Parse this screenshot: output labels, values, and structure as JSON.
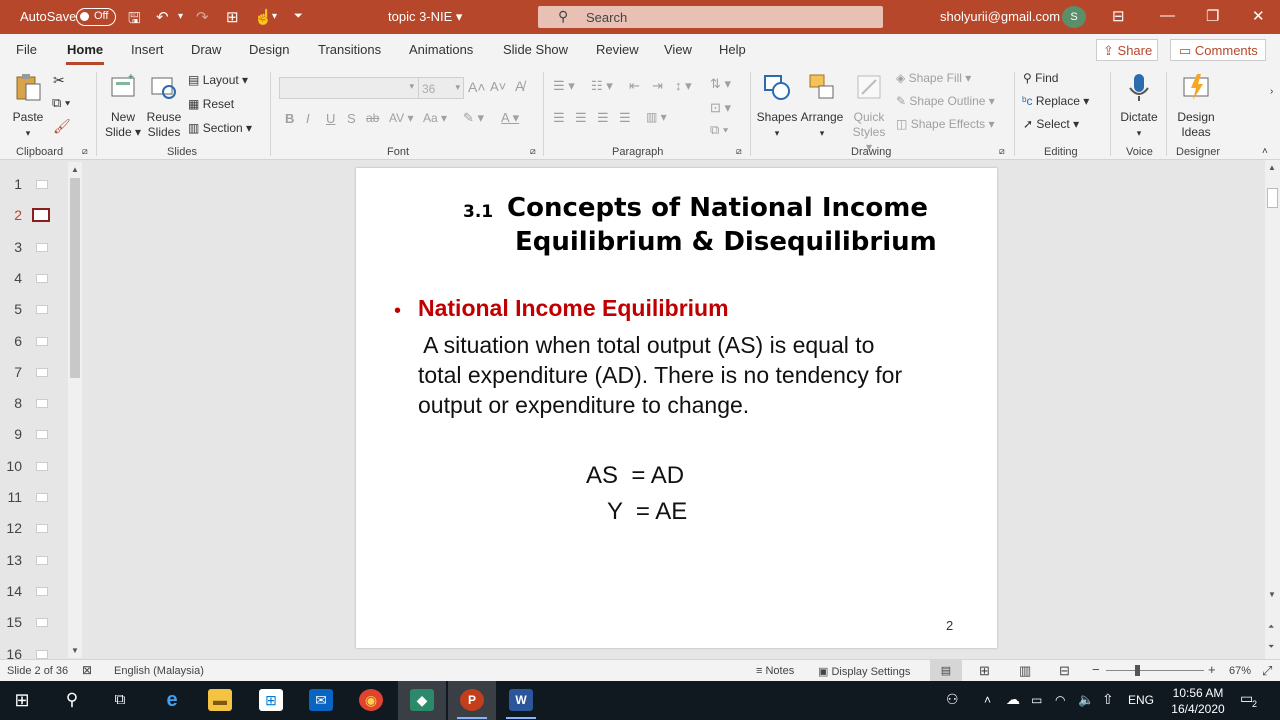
{
  "titlebar": {
    "autosave_label": "AutoSave",
    "autosave_state": "Off",
    "doc_title": "topic 3-NIE",
    "search_placeholder": "Search",
    "account_email": "sholyurii@gmail.com",
    "avatar_initial": "S"
  },
  "tabs": [
    "File",
    "Home",
    "Insert",
    "Draw",
    "Design",
    "Transitions",
    "Animations",
    "Slide Show",
    "Review",
    "View",
    "Help"
  ],
  "active_tab": "Home",
  "share_label": "Share",
  "comments_label": "Comments",
  "ribbon": {
    "clipboard": {
      "paste": "Paste",
      "group": "Clipboard"
    },
    "slides": {
      "new_slide_l1": "New",
      "new_slide_l2": "Slide",
      "reuse_l1": "Reuse",
      "reuse_l2": "Slides",
      "layout": "Layout",
      "reset": "Reset",
      "section": "Section",
      "group": "Slides"
    },
    "font": {
      "size": "36",
      "group": "Font"
    },
    "paragraph": {
      "group": "Paragraph"
    },
    "drawing": {
      "shapes": "Shapes",
      "arrange": "Arrange",
      "quick_l1": "Quick",
      "quick_l2": "Styles",
      "shape_fill": "Shape Fill",
      "shape_outline": "Shape Outline",
      "shape_effects": "Shape Effects",
      "group": "Drawing"
    },
    "editing": {
      "find": "Find",
      "replace": "Replace",
      "select": "Select",
      "group": "Editing"
    },
    "voice": {
      "dictate": "Dictate",
      "group": "Voice"
    },
    "designer": {
      "ideas_l1": "Design",
      "ideas_l2": "Ideas",
      "group": "Designer"
    }
  },
  "thumbnails": [
    "1",
    "2",
    "3",
    "4",
    "5",
    "6",
    "7",
    "8",
    "9",
    "10",
    "11",
    "12",
    "13",
    "14",
    "15",
    "16"
  ],
  "active_slide": 2,
  "slide": {
    "title_number": "3.1",
    "title_line1": "Concepts of National Income",
    "title_line2": "Equilibrium & Disequilibrium",
    "bullet": "•",
    "heading": "National Income Equilibrium",
    "body_line1": " A situation when total output (AS) is equal to",
    "body_line2": "total expenditure (AD). There is no tendency for",
    "body_line3": "output or expenditure to change.",
    "eq1": "AS  = AD",
    "eq2": "Y  = AE",
    "page_number": "2"
  },
  "status": {
    "slide_count": "Slide 2 of 36",
    "language": "English (Malaysia)",
    "notes": "Notes",
    "display_settings": "Display Settings",
    "zoom": "67%"
  },
  "taskbar": {
    "lang": "ENG",
    "time": "10:56 AM",
    "date": "16/4/2020",
    "notif_count": "2"
  },
  "colors": {
    "accent": "#b7472a",
    "slide_heading": "#c00000",
    "taskbar": "#101820"
  }
}
